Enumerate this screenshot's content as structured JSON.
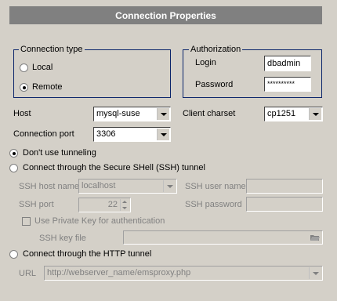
{
  "header": {
    "title": "Connection Properties"
  },
  "connection_type": {
    "legend": "Connection type",
    "options": [
      {
        "label": "Local",
        "selected": false
      },
      {
        "label": "Remote",
        "selected": true
      }
    ]
  },
  "authorization": {
    "legend": "Authorization",
    "login_label": "Login",
    "login_value": "dbadmin",
    "password_label": "Password",
    "password_value": "**********"
  },
  "host": {
    "label": "Host",
    "value": "mysql-suse"
  },
  "client_charset": {
    "label": "Client charset",
    "value": "cp1251"
  },
  "connection_port": {
    "label": "Connection port",
    "value": "3306"
  },
  "tunneling": {
    "no_tunnel_label": "Don't use tunneling",
    "ssh_tunnel_label": "Connect through the Secure SHell (SSH) tunnel",
    "http_tunnel_label": "Connect through the HTTP tunnel",
    "selected": "none"
  },
  "ssh": {
    "host_name_label": "SSH host name",
    "host_name_value": "localhost",
    "user_name_label": "SSH user name",
    "user_name_value": "",
    "port_label": "SSH port",
    "port_value": "22",
    "password_label": "SSH password",
    "password_value": "",
    "private_key_label": "Use Private Key for authentication",
    "key_file_label": "SSH key file",
    "key_file_value": ""
  },
  "http": {
    "url_label": "URL",
    "url_value": "http://webserver_name/emsproxy.php"
  }
}
